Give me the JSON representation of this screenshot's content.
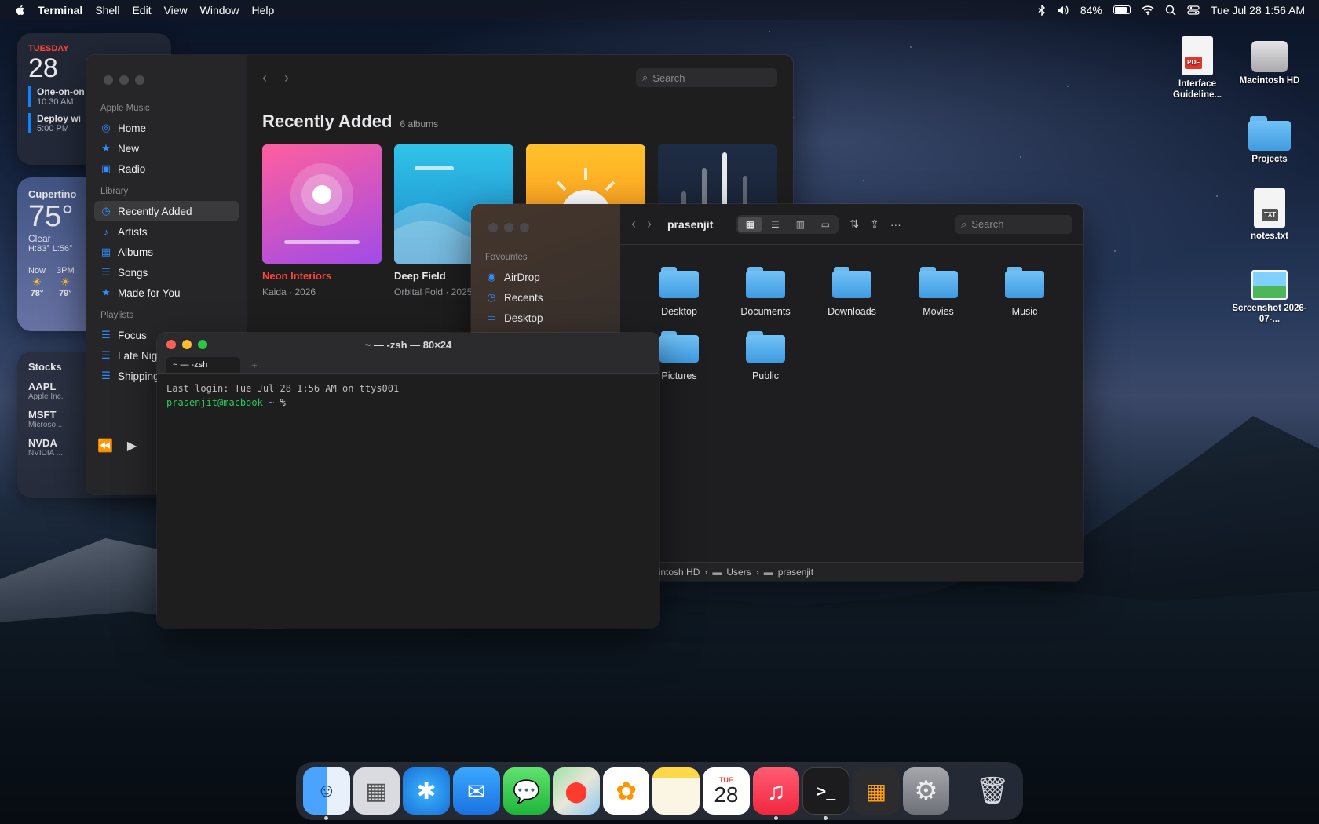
{
  "menubar": {
    "app_name": "Terminal",
    "menus": [
      "Shell",
      "Edit",
      "View",
      "Window",
      "Help"
    ],
    "battery_percent": "84%",
    "battery_level": 0.84,
    "datetime": "Tue Jul 28  1:56 AM"
  },
  "widgets": {
    "calendar": {
      "weekday": "TUESDAY",
      "day": "28",
      "events": [
        {
          "title": "One-on-on",
          "time": "10:30 AM"
        },
        {
          "title": "Deploy wi",
          "time": "5:00 PM"
        }
      ]
    },
    "weather": {
      "city": "Cupertino",
      "temp": "75°",
      "condition": "Clear",
      "hilo": "H:83° L:56°",
      "hours": [
        {
          "label": "Now",
          "temp": "78°"
        },
        {
          "label": "3PM",
          "temp": "79°"
        }
      ]
    },
    "stocks": {
      "title": "Stocks",
      "items": [
        {
          "ticker": "AAPL",
          "name": "Apple Inc.",
          "color": "#30d158"
        },
        {
          "ticker": "MSFT",
          "name": "Microso...",
          "color": "#ff453a"
        },
        {
          "ticker": "NVDA",
          "name": "NVIDIA ...",
          "color": "#ff453a"
        }
      ]
    }
  },
  "music": {
    "search_placeholder": "Search",
    "sections": {
      "apple_music": "Apple Music",
      "library": "Library",
      "playlists": "Playlists"
    },
    "apple_music_items": [
      {
        "label": "Home",
        "icon": "globe-icon"
      },
      {
        "label": "New",
        "icon": "star-icon"
      },
      {
        "label": "Radio",
        "icon": "radio-icon"
      }
    ],
    "library_items": [
      {
        "label": "Recently Added",
        "icon": "clock-icon"
      },
      {
        "label": "Artists",
        "icon": "mic-icon"
      },
      {
        "label": "Albums",
        "icon": "albums-icon"
      },
      {
        "label": "Songs",
        "icon": "list-icon"
      },
      {
        "label": "Made for You",
        "icon": "star-icon"
      }
    ],
    "playlist_items": [
      "Focus",
      "Late Nig",
      "Shipping"
    ],
    "heading": "Recently Added",
    "count": "6 albums",
    "albums": [
      {
        "title": "Neon Interiors",
        "artist": "Kaida · 2026",
        "title_color": "#ff453a"
      },
      {
        "title": "Deep Field",
        "artist": "Orbital Fold · 2025",
        "title_color": "#f1f1f3"
      },
      {
        "title": "",
        "artist": ""
      },
      {
        "title": "",
        "artist": ""
      }
    ],
    "accent": "#2f8cff"
  },
  "finder": {
    "title": "prasenjit",
    "search_placeholder": "Search",
    "section": "Favourites",
    "sidebar_items": [
      {
        "label": "AirDrop",
        "icon": "airdrop-icon"
      },
      {
        "label": "Recents",
        "icon": "clock-icon"
      },
      {
        "label": "Desktop",
        "icon": "desktop-icon"
      }
    ],
    "folders": [
      "Desktop",
      "Documents",
      "Downloads",
      "Movies",
      "Music",
      "Pictures",
      "Public"
    ],
    "path": [
      "acintosh HD",
      "Users",
      "prasenjit"
    ]
  },
  "terminal": {
    "title": "~ — -zsh — 80×24",
    "tab_label": "~ — -zsh",
    "tab_add": "+",
    "last_login": "Last login: Tue Jul 28 1:56 AM on ttys001",
    "prompt_user": "prasenjit@macbook",
    "prompt_dir": "~",
    "prompt_symbol": "%"
  },
  "desktop_icons": [
    {
      "label": "Interface Guideline...",
      "icon": "pdf-document-icon",
      "badge": "PDF"
    },
    {
      "label": "Macintosh HD",
      "icon": "hard-drive-icon"
    },
    {
      "label": "Projects",
      "icon": "folder-icon"
    },
    {
      "label": "notes.txt",
      "icon": "text-document-icon",
      "badge": "TXT"
    },
    {
      "label": "Screenshot 2026-07-...",
      "icon": "image-icon"
    }
  ],
  "dock": {
    "calendar_month": "TUE",
    "calendar_day": "28",
    "apps": [
      "finder-icon",
      "launchpad-icon",
      "safari-icon",
      "mail-icon",
      "messages-icon",
      "maps-icon",
      "photos-icon",
      "notes-icon",
      "calendar-icon",
      "music-icon",
      "terminal-icon",
      "calculator-icon",
      "settings-icon",
      "trash-icon"
    ]
  }
}
